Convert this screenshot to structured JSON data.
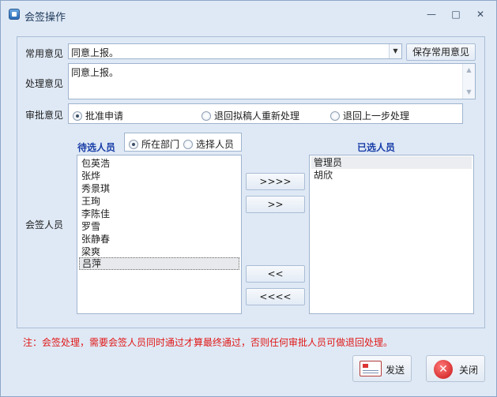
{
  "window": {
    "title": "会签操作",
    "minimize_label": "—",
    "maximize_label": "□",
    "close_label": "✕"
  },
  "common_opinion": {
    "label": "常用意见",
    "value": "同意上报。",
    "save_button": "保存常用意见"
  },
  "handle_opinion": {
    "label": "处理意见",
    "value": "同意上报。"
  },
  "approval": {
    "label": "审批意见",
    "options": [
      {
        "label": "批准申请",
        "selected": true
      },
      {
        "label": "退回拟稿人重新处理",
        "selected": false
      },
      {
        "label": "退回上一步处理",
        "selected": false
      }
    ]
  },
  "countersign": {
    "label": "会签人员",
    "candidates_title": "待选人员",
    "selected_title": "已选人员",
    "scope_options": [
      {
        "label": "所在部门",
        "selected": true
      },
      {
        "label": "选择人员",
        "selected": false
      }
    ],
    "candidates": [
      "包英浩",
      "张烨",
      "秀景琪",
      "王珣",
      "李陈佳",
      "罗雪",
      "张静春",
      "梁爽",
      "吕萍"
    ],
    "selected_people": [
      "管理员",
      "胡欣"
    ],
    "buttons": {
      "add_all": ">>>>",
      "add": ">>",
      "remove": "<<",
      "remove_all": "<<<<"
    }
  },
  "note": "注：会签处理，需要会签人员同时通过才算最终通过，否则任何审批人员可做退回处理。",
  "actions": {
    "send": "发送",
    "close": "关闭"
  }
}
